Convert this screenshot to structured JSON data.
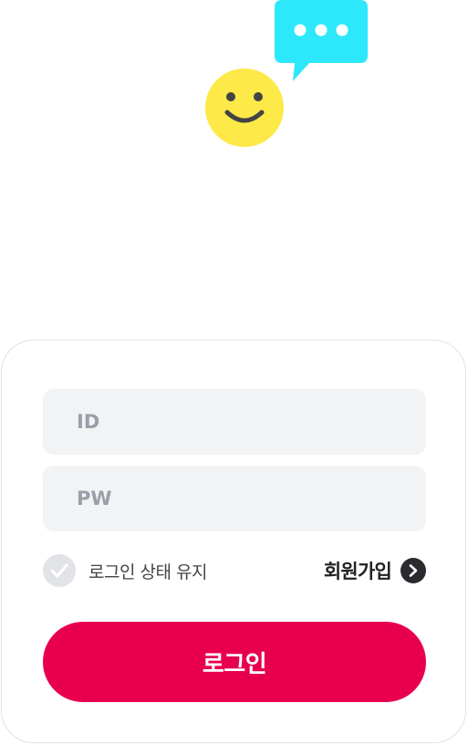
{
  "illustration": {
    "smiley_color": "#fde947",
    "bubble_color": "#2de8fb",
    "icons": [
      "smiley-face-icon",
      "speech-bubble-icon"
    ]
  },
  "login_form": {
    "id_placeholder": "ID",
    "pw_placeholder": "PW",
    "id_value": "",
    "pw_value": "",
    "keep_login_label": "로그인 상태 유지",
    "keep_login_checked": false,
    "signup_label": "회원가입",
    "login_button_label": "로그인"
  },
  "colors": {
    "accent": "#e8004e",
    "field_background": "#f2f3f5",
    "placeholder": "#9aa0a8",
    "dark_text": "#222222"
  }
}
